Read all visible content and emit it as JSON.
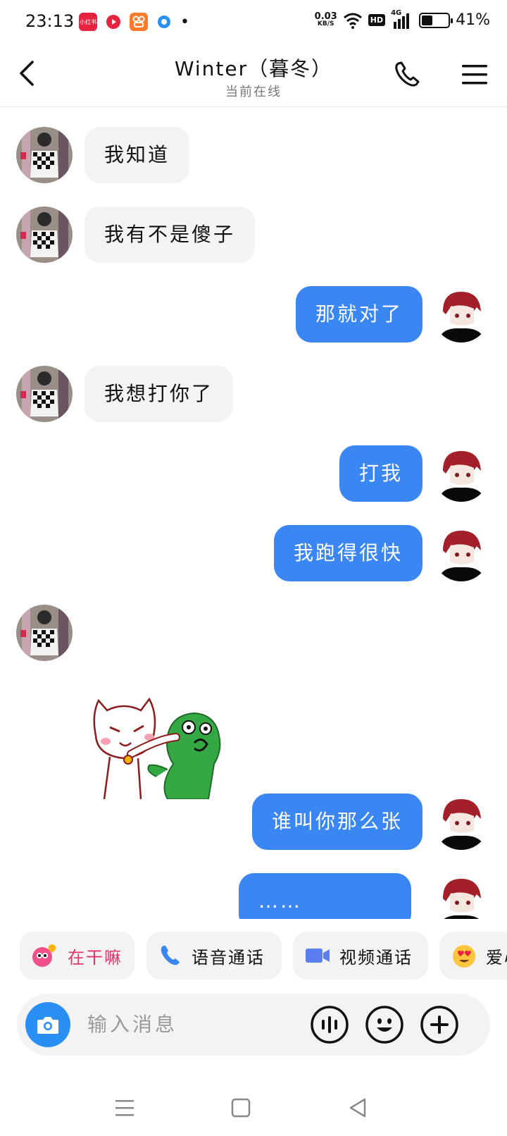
{
  "status_bar": {
    "time": "23:13",
    "app_icons": [
      "xiaohongshu-icon",
      "video-app-icon",
      "kuaishou-icon",
      "browser-app-icon"
    ],
    "app_icon_label": "小红书",
    "dot": "•",
    "net_speed_value": "0.03",
    "net_speed_unit": "KB/S",
    "hd_label": "HD",
    "signal_label": "4G",
    "battery_level_fraction": 0.41,
    "battery_percent": "41%"
  },
  "header": {
    "title": "Winter（暮冬）",
    "subtitle": "当前在线",
    "back_icon": "chevron-left-icon",
    "call_icon": "phone-icon",
    "menu_icon": "menu-icon"
  },
  "messages": [
    {
      "side": "in",
      "text": "我知道"
    },
    {
      "side": "in",
      "text": "我有不是傻子"
    },
    {
      "side": "out",
      "text": "那就对了"
    },
    {
      "side": "in",
      "text": "我想打你了"
    },
    {
      "side": "out",
      "text": "打我"
    },
    {
      "side": "out",
      "text": "我跑得很快"
    },
    {
      "side": "in",
      "type": "sticker",
      "sticker_icon": "cat-punching-sticker"
    },
    {
      "side": "out",
      "text": "谁叫你那么张"
    },
    {
      "side": "out",
      "text": "……"
    }
  ],
  "quick_actions": [
    {
      "label": "在干嘛",
      "icon": "heart-chat-icon"
    },
    {
      "label": "语音通话",
      "icon": "phone-icon"
    },
    {
      "label": "视频通话",
      "icon": "video-camera-icon"
    },
    {
      "label": "爱心",
      "icon": "heart-eyes-emoji-icon"
    }
  ],
  "input": {
    "placeholder": "输入消息",
    "camera_icon": "camera-icon",
    "voice_icon": "voice-wave-icon",
    "emoji_icon": "smiley-icon",
    "plus_icon": "plus-icon"
  },
  "nav": {
    "menu_icon": "nav-menu-icon",
    "home_icon": "nav-home-icon",
    "back_icon": "nav-back-icon"
  },
  "colors": {
    "outgoing_bubble": "#3a86f3",
    "incoming_bubble": "#f3f3f3",
    "camera_button": "#2a8ff5",
    "quick_action_text": "#e0336a"
  }
}
